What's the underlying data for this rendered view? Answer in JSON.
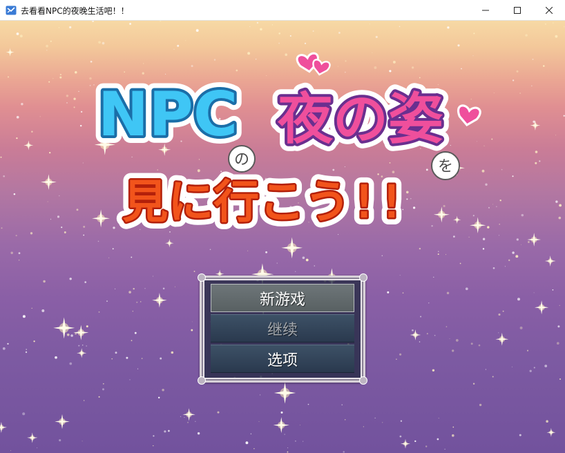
{
  "window": {
    "title": "去看看NPC的夜晚生活吧！！"
  },
  "logo": {
    "npc": "NPC",
    "no": "の",
    "yoru_no_sugata": "夜の姿",
    "wo": "を",
    "mini_ikou": "見に行こう!!"
  },
  "menu": {
    "items": [
      {
        "label": "新游戏",
        "state": "selected"
      },
      {
        "label": "继续",
        "state": "disabled"
      },
      {
        "label": "选项",
        "state": "normal"
      }
    ]
  },
  "colors": {
    "npc_blue": "#3fc6f5",
    "pink": "#ef4f9c",
    "purple_outline": "#6a2f8f",
    "orange_red": "#f2541b",
    "sky_top": "#f7d9a5",
    "sky_bottom": "#72529d"
  },
  "icons": [
    "app-icon",
    "minimize-icon",
    "maximize-icon",
    "close-icon",
    "heart-icon"
  ]
}
